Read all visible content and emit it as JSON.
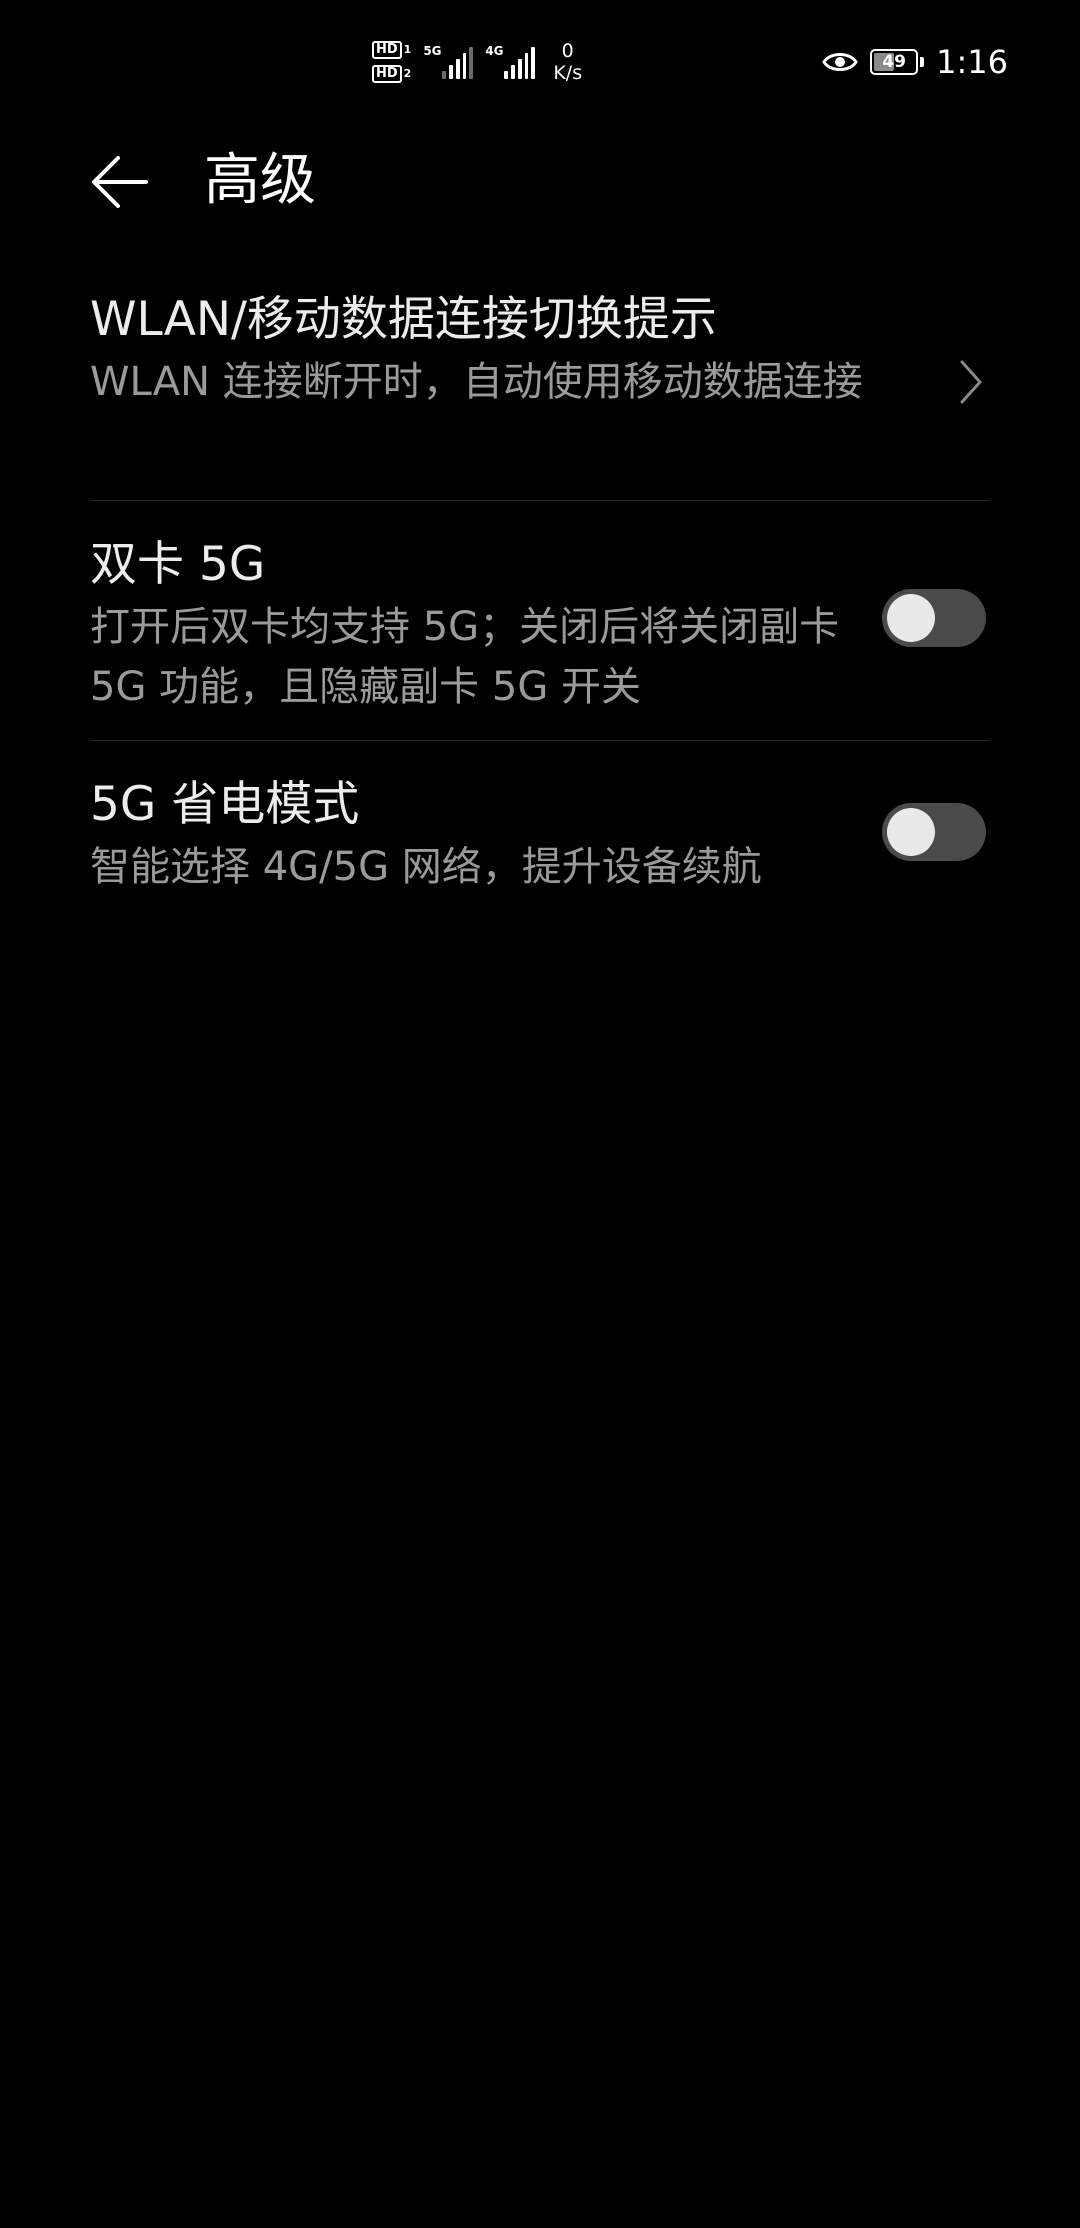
{
  "status_bar": {
    "sim1_label": "HD",
    "sim1_num": "1",
    "sim2_label": "HD",
    "sim2_num": "2",
    "sim1_network": "5G",
    "sim2_network": "4G",
    "speed_value": "0",
    "speed_unit": "K/s",
    "battery_level": "49",
    "time": "1:16",
    "icons": [
      "hd-icon",
      "signal-icon",
      "eye-icon",
      "battery-icon"
    ]
  },
  "header": {
    "back_icon": "arrow-left-icon",
    "title": "高级"
  },
  "settings": {
    "items": [
      {
        "title": "WLAN/移动数据连接切换提示",
        "subtitle": "WLAN 连接断开时，自动使用移动数据连接",
        "control": "chevron",
        "icon": "chevron-right-icon"
      },
      {
        "title": "双卡 5G",
        "subtitle": "打开后双卡均支持 5G；关闭后将关闭副卡 5G 功能，且隐藏副卡 5G 开关",
        "control": "toggle",
        "state": "off"
      },
      {
        "title": "5G 省电模式",
        "subtitle": "智能选择 4G/5G 网络，提升设备续航",
        "control": "toggle",
        "state": "off"
      }
    ]
  },
  "colors": {
    "background": "#000000",
    "title_text": "#ececec",
    "subtitle_text": "#9a9a9a",
    "toggle_track_off": "#4a4a4a",
    "toggle_knob": "#e9e9e9",
    "divider": "#2a2a2a"
  }
}
